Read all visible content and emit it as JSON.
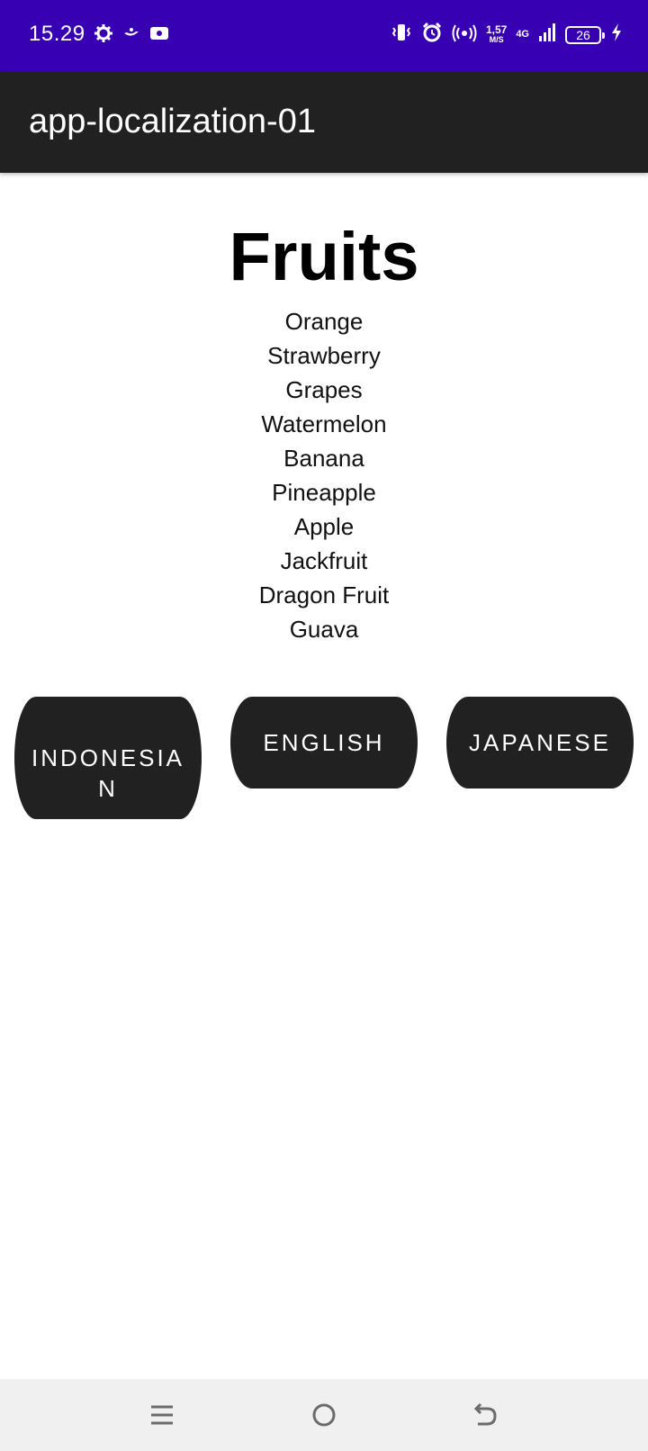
{
  "status_bar": {
    "time": "15.29",
    "net_speed_value": "1,57",
    "net_speed_unit": "M/S",
    "net_type": "4G",
    "battery_level": "26",
    "left_icons": [
      "gear-icon",
      "genie-lamp-icon",
      "video-camera-icon"
    ],
    "right_icons": [
      "vibrate-icon",
      "alarm-icon",
      "hotspot-icon",
      "signal-icon",
      "battery-icon",
      "charging-icon"
    ]
  },
  "app_bar": {
    "title": "app-localization-01"
  },
  "main": {
    "heading": "Fruits",
    "fruits": [
      "Orange",
      "Strawberry",
      "Grapes",
      "Watermelon",
      "Banana",
      "Pineapple",
      "Apple",
      "Jackfruit",
      "Dragon Fruit",
      "Guava"
    ]
  },
  "buttons": {
    "indonesian_line1": "INDONESIA",
    "indonesian_line2": "N",
    "english": "ENGLISH",
    "japanese": "JAPANESE"
  },
  "nav_bar": {
    "icons": [
      "menu-icon",
      "home-icon",
      "back-icon"
    ]
  },
  "colors": {
    "status_bar": "#3700b3",
    "app_bar": "#212121",
    "button": "#212121",
    "nav_bar": "#f0f0f0"
  }
}
